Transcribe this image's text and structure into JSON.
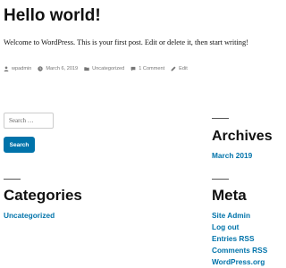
{
  "post": {
    "title": "Hello world!",
    "content": "Welcome to WordPress. This is your first post. Edit or delete it, then start writing!",
    "meta": {
      "author": "wpadmin",
      "date": "March 6, 2019",
      "category": "Uncategorized",
      "comments": "1 Comment",
      "edit": "Edit"
    }
  },
  "search": {
    "placeholder": "Search …",
    "button_label": "Search"
  },
  "widgets": {
    "archives": {
      "title": "Archives",
      "items": [
        "March 2019"
      ]
    },
    "categories": {
      "title": "Categories",
      "items": [
        "Uncategorized"
      ]
    },
    "meta": {
      "title": "Meta",
      "items": [
        "Site Admin",
        "Log out",
        "Entries RSS",
        "Comments RSS",
        "WordPress.org"
      ]
    }
  },
  "colors": {
    "link": "#0073aa",
    "button": "#0073aa",
    "meta_text": "#767676"
  }
}
